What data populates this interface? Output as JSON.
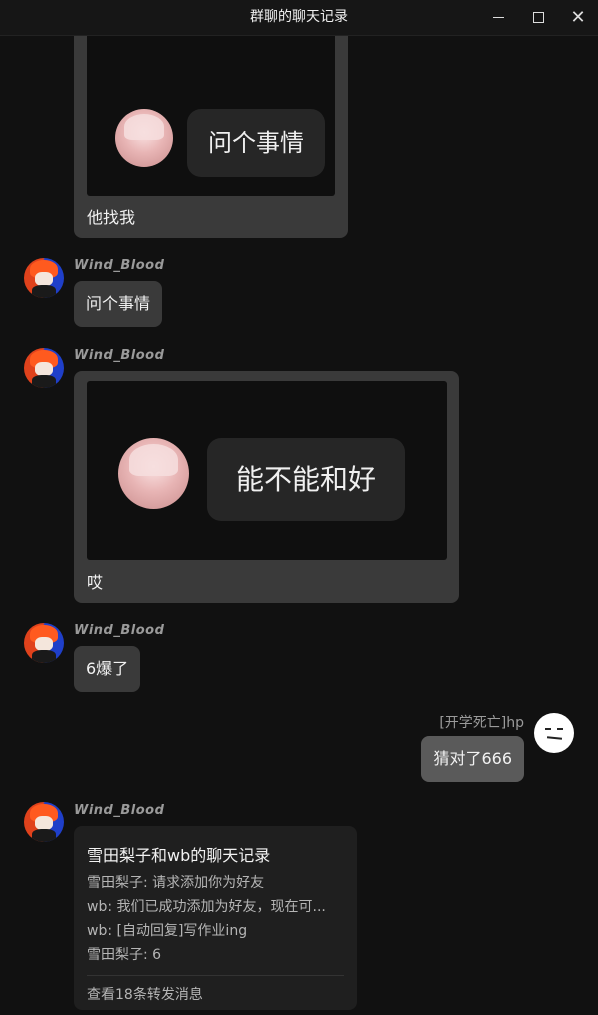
{
  "window": {
    "title": "群聊的聊天记录",
    "minimize": "minimize",
    "maximize": "maximize",
    "close": "close"
  },
  "messages": {
    "m1": {
      "image_text": "问个事情",
      "caption": "他找我"
    },
    "m2": {
      "sender": "Wind_Blood",
      "text": "问个事情"
    },
    "m3": {
      "sender": "Wind_Blood",
      "image_text": "能不能和好",
      "caption": "哎"
    },
    "m4": {
      "sender": "Wind_Blood",
      "text": "6爆了"
    },
    "m5": {
      "sender": "[开学死亡]hp",
      "text": "猜对了666"
    },
    "m6": {
      "sender": "Wind_Blood",
      "forward": {
        "title": "雪田梨子和wb的聊天记录",
        "lines": [
          "雪田梨子: 请求添加你为好友",
          "wb: 我们已成功添加为好友，现在可...",
          "wb: [自动回复]写作业ing",
          "雪田梨子: 6"
        ],
        "footer": "查看18条转发消息"
      }
    }
  },
  "icons": {
    "minimize": "minimize-icon",
    "maximize": "maximize-icon",
    "close": "close-icon"
  }
}
